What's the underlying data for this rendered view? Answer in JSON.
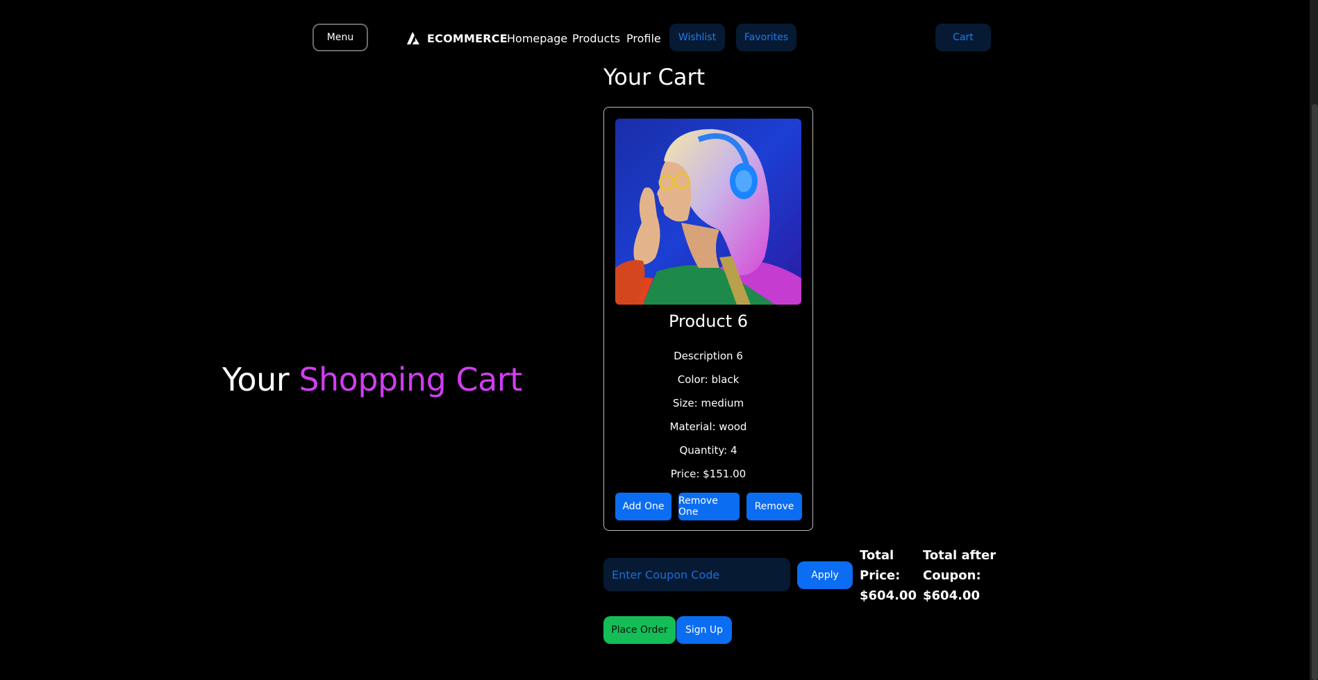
{
  "navbar": {
    "menu_label": "Menu",
    "brand_name": "ECOMMERCE",
    "links": [
      "Homepage",
      "Products",
      "Profile"
    ],
    "wishlist_label": "Wishlist",
    "favorites_label": "Favorites",
    "cart_label": "Cart"
  },
  "hero": {
    "prefix": "Your",
    "highlight": "Shopping Cart"
  },
  "cart": {
    "heading": "Your Cart",
    "item": {
      "name": "Product 6",
      "description": "Description 6",
      "color": "Color: black",
      "size": "Size: medium",
      "material": "Material: wood",
      "quantity": "Quantity: 4",
      "price": "Price: $151.00",
      "buttons": {
        "add_one": "Add One",
        "remove_one": "Remove One",
        "remove": "Remove"
      }
    }
  },
  "coupon": {
    "placeholder": "Enter Coupon Code",
    "value": "",
    "apply_label": "Apply"
  },
  "totals": {
    "total_label_1": "Total",
    "total_label_2": "Price:",
    "total_value": "$604.00",
    "after_label_1": "Total after",
    "after_label_2": "Coupon:",
    "after_value": "$604.00"
  },
  "actions": {
    "place_order_label": "Place Order",
    "signup_label": "Sign Up"
  },
  "colors": {
    "accent_magenta": "#d13df0",
    "primary_blue": "#0b6df2",
    "dark_blue_fill": "#061a33",
    "success_green": "#15bd57"
  }
}
